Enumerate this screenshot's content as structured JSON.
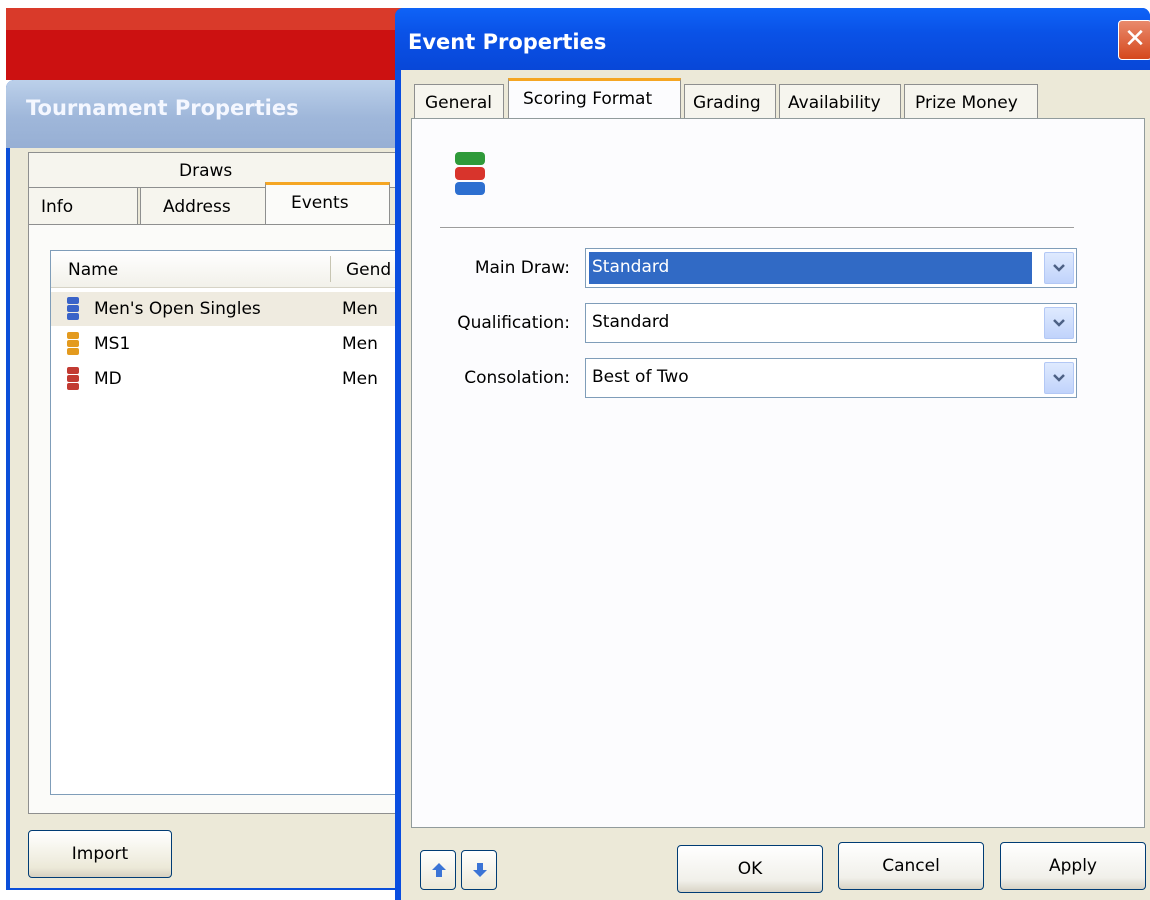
{
  "tournament_window": {
    "title": "Tournament Properties",
    "tabs_back": [
      "Draws"
    ],
    "tabs_front": [
      "Info",
      "Address",
      "Events"
    ],
    "active_tab": "Events",
    "list_columns": [
      "Name",
      "Gend"
    ],
    "rows": [
      {
        "name": "Men's Open Singles",
        "gender": "Men",
        "icon": "event-blue-icon",
        "color": "#3a63c8"
      },
      {
        "name": "MS1",
        "gender": "Men",
        "icon": "event-orange-icon",
        "color": "#e39a1e"
      },
      {
        "name": "MD",
        "gender": "Men",
        "icon": "event-red-icon",
        "color": "#c23a32"
      }
    ],
    "import_label": "Import"
  },
  "event_window": {
    "title": "Event Properties",
    "close_glyph": "✕",
    "tabs": [
      "General",
      "Scoring Format",
      "Grading",
      "Availability",
      "Prize Money"
    ],
    "active_tab": "Scoring Format",
    "fields": [
      {
        "label": "Main Draw:",
        "value": "Standard",
        "selected": true
      },
      {
        "label": "Qualification:",
        "value": "Standard",
        "selected": false
      },
      {
        "label": "Consolation:",
        "value": "Best of Two",
        "selected": false
      }
    ],
    "buttons": {
      "ok": "OK",
      "cancel": "Cancel",
      "apply": "Apply"
    },
    "nav": {
      "up_icon": "arrow-up-icon",
      "down_icon": "arrow-down-icon"
    }
  },
  "colors": {
    "xp_title_blue": "#0a52e7",
    "selection_blue": "#316ac5",
    "window_face": "#ece9d8",
    "tab_accent": "#f5a623"
  }
}
